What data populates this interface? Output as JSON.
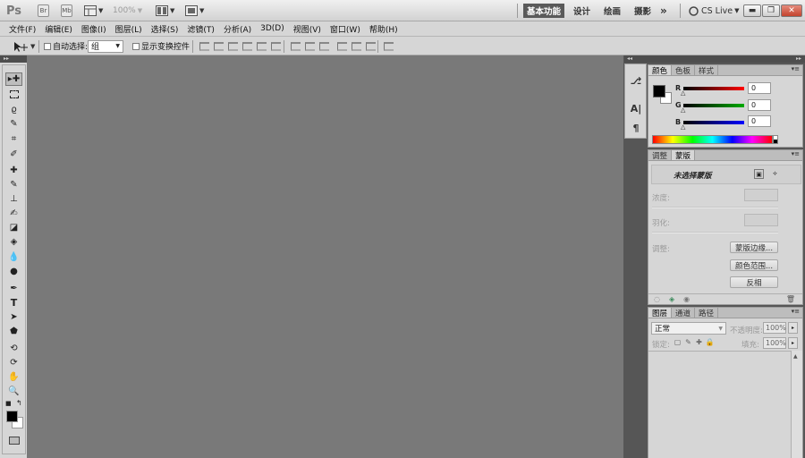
{
  "app": {
    "logo": "Ps",
    "bridge_label": "Br",
    "minibridge_label": "Mb",
    "zoom": "100%"
  },
  "workspaces": {
    "active": "基本功能",
    "items": [
      "设计",
      "绘画",
      "摄影"
    ],
    "more": "»",
    "cs_live": "CS Live"
  },
  "menu": [
    "文件(F)",
    "编辑(E)",
    "图像(I)",
    "图层(L)",
    "选择(S)",
    "滤镜(T)",
    "分析(A)",
    "3D(D)",
    "视图(V)",
    "窗口(W)",
    "帮助(H)"
  ],
  "options": {
    "auto_select_label": "自动选择:",
    "auto_select_value": "组",
    "show_transform_label": "显示变换控件"
  },
  "tools": [
    "move",
    "marquee",
    "lasso",
    "quick-select",
    "crop",
    "eyedropper",
    "healing",
    "brush",
    "stamp",
    "history-brush",
    "eraser",
    "gradient",
    "blur",
    "dodge",
    "pen",
    "type",
    "path-select",
    "shape",
    "3d-rotate",
    "3d-orbit",
    "hand",
    "zoom"
  ],
  "color_panel": {
    "tabs": [
      "颜色",
      "色板",
      "样式"
    ],
    "channels": [
      {
        "label": "R",
        "value": "0",
        "gradient": "#ff0000"
      },
      {
        "label": "G",
        "value": "0",
        "gradient": "#00aa00"
      },
      {
        "label": "B",
        "value": "0",
        "gradient": "#0000ff"
      }
    ]
  },
  "mask_panel": {
    "tabs": [
      "调整",
      "蒙版"
    ],
    "no_mask": "未选择蒙版",
    "density_label": "浓度:",
    "feather_label": "羽化:",
    "refine_label": "调整:",
    "mask_edge_btn": "蒙版边缘...",
    "color_range_btn": "颜色范围...",
    "invert_btn": "反相"
  },
  "layers_panel": {
    "tabs": [
      "图层",
      "通道",
      "路径"
    ],
    "blend_mode": "正常",
    "opacity_label": "不透明度:",
    "opacity_value": "100%",
    "lock_label": "锁定:",
    "fill_label": "填充:",
    "fill_value": "100%"
  }
}
